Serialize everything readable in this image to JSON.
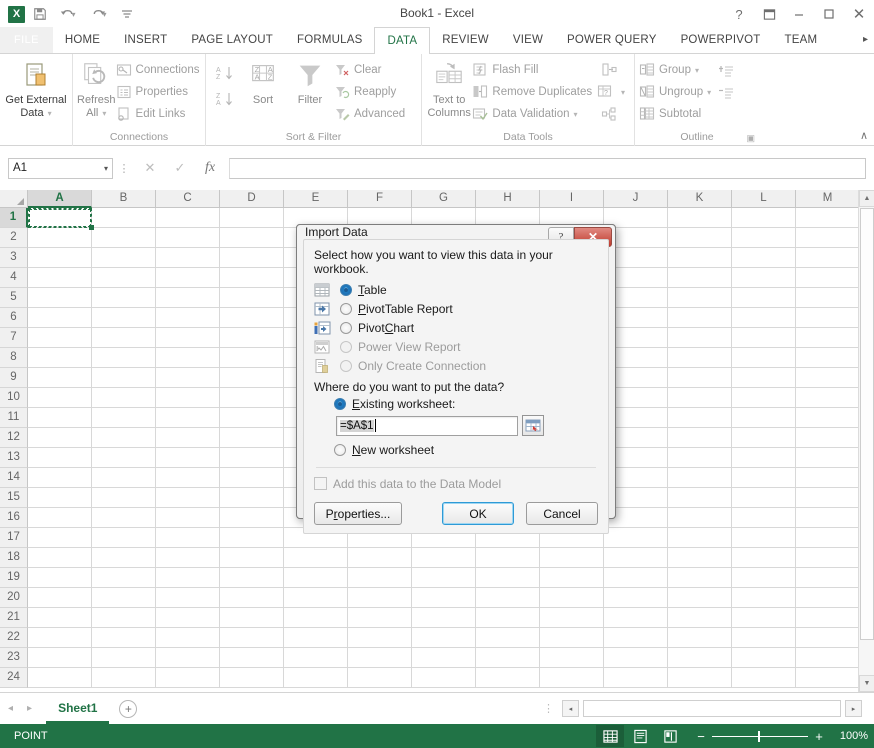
{
  "window": {
    "title": "Book1 - Excel",
    "quick_access": [
      "save-icon",
      "undo-icon",
      "redo-icon",
      "customize-icon"
    ],
    "help_label": "?",
    "ribbon_display_label": "⤒",
    "minimize_label": "–",
    "restore_label": "❑",
    "close_label": "✕"
  },
  "tabs": {
    "file": "FILE",
    "items": [
      {
        "label": "HOME",
        "active": false
      },
      {
        "label": "INSERT",
        "active": false
      },
      {
        "label": "PAGE LAYOUT",
        "active": false
      },
      {
        "label": "FORMULAS",
        "active": false
      },
      {
        "label": "DATA",
        "active": true
      },
      {
        "label": "REVIEW",
        "active": false
      },
      {
        "label": "VIEW",
        "active": false
      },
      {
        "label": "POWER QUERY",
        "active": false
      },
      {
        "label": "POWERPIVOT",
        "active": false
      },
      {
        "label": "TEAM",
        "active": false
      }
    ],
    "overflow": "▸"
  },
  "ribbon": {
    "groups": [
      {
        "name": "get-external-data",
        "label": "",
        "big": {
          "label1": "Get External",
          "label2": "Data",
          "caret": "▾"
        }
      },
      {
        "name": "connections",
        "label": "Connections",
        "big": {
          "label1": "Refresh",
          "label2": "All",
          "caret": "▾"
        },
        "items": [
          "Connections",
          "Properties",
          "Edit Links"
        ]
      },
      {
        "name": "sort-filter",
        "label": "Sort & Filter",
        "sort_label": "Sort",
        "filter_label": "Filter",
        "items": [
          "Clear",
          "Reapply",
          "Advanced"
        ]
      },
      {
        "name": "data-tools",
        "label": "Data Tools",
        "big": {
          "label1": "Text to",
          "label2": "Columns"
        },
        "items": [
          "Flash Fill",
          "Remove Duplicates",
          "Data Validation"
        ]
      },
      {
        "name": "outline",
        "label": "Outline",
        "items": [
          "Group",
          "Ungroup",
          "Subtotal"
        ]
      }
    ],
    "collapse_label": "∧"
  },
  "formula_bar": {
    "name_box_value": "A1",
    "name_box_caret": "▾",
    "cancel_icon": "✕",
    "enter_icon": "✓",
    "function_icon": "fx",
    "formula_value": ""
  },
  "grid": {
    "columns": [
      "A",
      "B",
      "C",
      "D",
      "E",
      "F",
      "G",
      "H",
      "I",
      "J",
      "K",
      "L",
      "M"
    ],
    "rows": [
      1,
      2,
      3,
      4,
      5,
      6,
      7,
      8,
      9,
      10,
      11,
      12,
      13,
      14,
      15,
      16,
      17,
      18,
      19,
      20,
      21,
      22,
      23,
      24
    ],
    "active_cell": "A1",
    "selection_color": "#217346"
  },
  "sheet_bar": {
    "prev_label": "◂",
    "next_label": "▸",
    "tabs": [
      {
        "label": "Sheet1",
        "active": true
      }
    ],
    "add_sheet_label": "+",
    "menu_dots": "⋮",
    "hscroll_left": "◂",
    "hscroll_right": "▸"
  },
  "status_bar": {
    "mode": "POINT",
    "views": [
      {
        "name": "normal-view",
        "icon": "▦",
        "active": true
      },
      {
        "name": "page-layout-view",
        "icon": "▤",
        "active": false
      },
      {
        "name": "page-break-preview",
        "icon": "▥",
        "active": false
      }
    ],
    "zoom_out": "−",
    "zoom_in": "+",
    "zoom_level": "100%"
  },
  "dialog": {
    "title": "Import Data",
    "help_btn": "?",
    "close_btn": "✕",
    "question_view": "Select how you want to view this data in your workbook.",
    "view_options": [
      {
        "label_pre": "",
        "label_key": "T",
        "label_post": "able",
        "selected": true,
        "disabled": false,
        "icon": "table-icon"
      },
      {
        "label_pre": "",
        "label_key": "P",
        "label_post": "ivotTable Report",
        "selected": false,
        "disabled": false,
        "icon": "pivottable-icon"
      },
      {
        "label_pre": "Pivot",
        "label_key": "C",
        "label_post": "hart",
        "selected": false,
        "disabled": false,
        "icon": "pivotchart-icon"
      },
      {
        "label_pre": "Power View Report",
        "label_key": "",
        "label_post": "",
        "selected": false,
        "disabled": true,
        "icon": "powerview-icon"
      },
      {
        "label_pre": "Only Create Connection",
        "label_key": "",
        "label_post": "",
        "selected": false,
        "disabled": true,
        "icon": "connection-icon"
      }
    ],
    "question_place": "Where do you want to put the data?",
    "existing_pre": "",
    "existing_key": "E",
    "existing_post": "xisting worksheet:",
    "existing_selected": true,
    "reference_value": "=$A$1",
    "range_picker_icon": "range-select-icon",
    "new_pre": "",
    "new_key": "N",
    "new_post": "ew worksheet",
    "new_selected": false,
    "data_model_label": "Add this data to the Data Model",
    "data_model_checked": false,
    "data_model_disabled": true,
    "properties_pre": "P",
    "properties_key": "r",
    "properties_post": "operties...",
    "ok_label": "OK",
    "cancel_label": "Cancel"
  }
}
